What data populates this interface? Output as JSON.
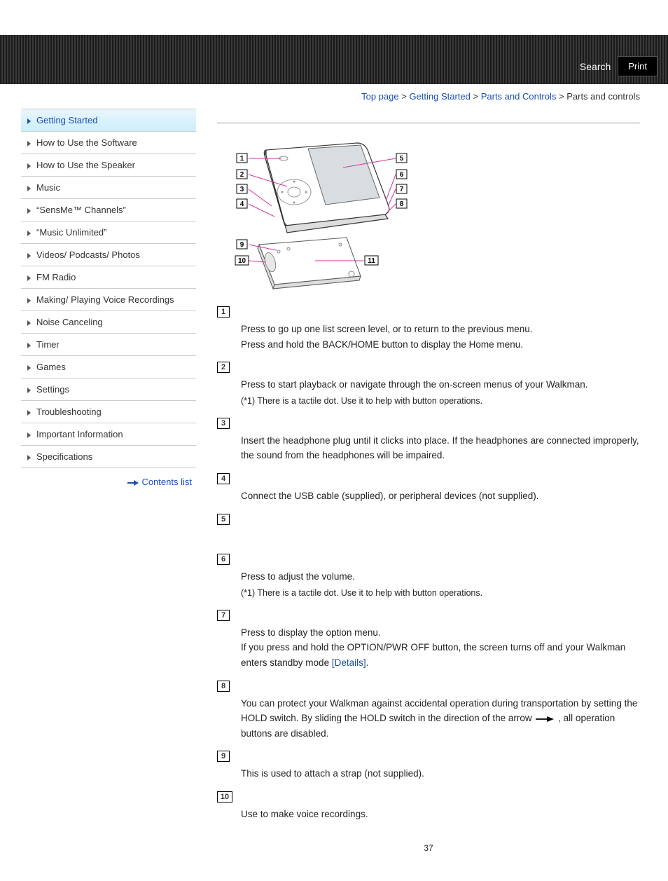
{
  "topbar": {
    "search": "Search",
    "print": "Print"
  },
  "breadcrumb": {
    "items": [
      "Top page",
      "Getting Started",
      "Parts and Controls"
    ],
    "current": "Parts and controls",
    "sep": " > "
  },
  "sidebar": {
    "items": [
      {
        "label": "Getting Started",
        "active": true
      },
      {
        "label": "How to Use the Software"
      },
      {
        "label": "How to Use the Speaker"
      },
      {
        "label": "Music"
      },
      {
        "label": "“SensMe™ Channels”"
      },
      {
        "label": "“Music Unlimited”"
      },
      {
        "label": "Videos/ Podcasts/ Photos"
      },
      {
        "label": "FM Radio"
      },
      {
        "label": "Making/ Playing Voice Recordings"
      },
      {
        "label": "Noise Canceling"
      },
      {
        "label": "Timer"
      },
      {
        "label": "Games"
      },
      {
        "label": "Settings"
      },
      {
        "label": "Troubleshooting"
      },
      {
        "label": "Important Information"
      },
      {
        "label": "Specifications"
      }
    ],
    "contents_link": "Contents list"
  },
  "parts": {
    "1": {
      "line1": "Press to go up one list screen level, or to return to the previous menu.",
      "line2": "Press and hold the BACK/HOME button to display the Home menu."
    },
    "2": {
      "line1": "Press to start playback or navigate through the on-screen menus of your Walkman.",
      "note": "(*1) There is a tactile dot. Use it to help with button operations."
    },
    "3": {
      "line1": "Insert the headphone plug until it clicks into place. If the headphones are connected improperly, the sound from the headphones will be impaired."
    },
    "4": {
      "line1": "Connect the USB cable (supplied), or peripheral devices (not supplied)."
    },
    "5": {},
    "6": {
      "line1": "Press to adjust the volume.",
      "note": "(*1) There is a tactile dot. Use it to help with button operations."
    },
    "7": {
      "line1": "Press to display the option menu.",
      "line2a": "If you press and hold the OPTION/PWR OFF button, the screen turns off and your Walkman enters standby mode ",
      "details": "[Details]",
      "line2b": "."
    },
    "8": {
      "line1a": "You can protect your Walkman against accidental operation during transportation by setting the HOLD switch. By sliding the HOLD switch in the direction of the arrow ",
      "line1b": " , all operation buttons are disabled."
    },
    "9": {
      "line1": "This is used to attach a strap (not supplied)."
    },
    "10": {
      "line1": "Use to make voice recordings."
    }
  },
  "pagenum": "37"
}
